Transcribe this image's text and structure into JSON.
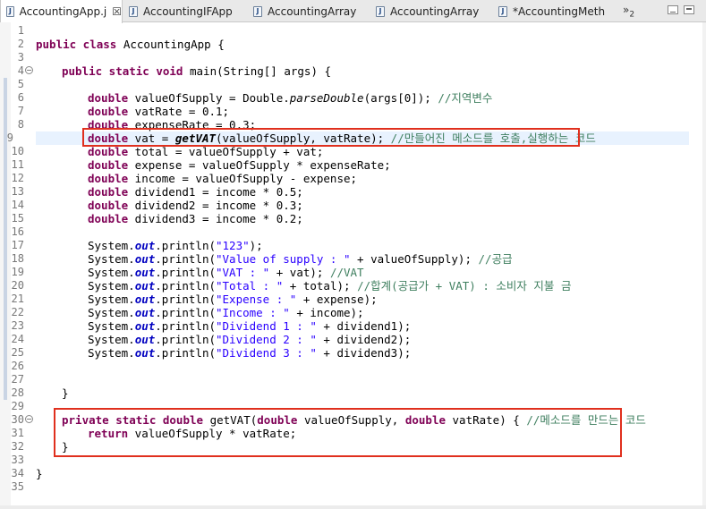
{
  "tabs": [
    {
      "label": "AccountingApp.j",
      "close": "☒",
      "active": true,
      "icon": "java-file-icon"
    },
    {
      "label": "AccountingIFApp",
      "active": false,
      "icon": "java-file-icon"
    },
    {
      "label": "AccountingArray",
      "active": false,
      "icon": "java-file-icon"
    },
    {
      "label": "AccountingArray",
      "active": false,
      "icon": "java-file-icon"
    },
    {
      "label": "*AccountingMeth",
      "active": false,
      "icon": "java-file-icon"
    }
  ],
  "overflow": {
    "symbol": "»",
    "count": "2"
  },
  "editor": {
    "current_line": 9,
    "line_numbers": [
      "1",
      "2",
      "3",
      "4",
      "5",
      "6",
      "7",
      "8",
      "9",
      "10",
      "11",
      "12",
      "13",
      "14",
      "15",
      "16",
      "17",
      "18",
      "19",
      "20",
      "21",
      "22",
      "23",
      "24",
      "25",
      "26",
      "27",
      "28",
      "29",
      "30",
      "31",
      "32",
      "33",
      "34",
      "35"
    ],
    "code": {
      "l2_kw": "public class",
      "l2_rest": " AccountingApp {",
      "l4_kw": "public static void",
      "l4_rest": " main(String[] args) {",
      "l6_kw": "double",
      "l6_a": " valueOfSupply = Double.",
      "l6_m": "parseDouble",
      "l6_b": "(args[0]); ",
      "l6_c": "//지역변수",
      "l7_kw": "double",
      "l7_rest": " vatRate = 0.1;",
      "l8_kw": "double",
      "l8_rest": " expenseRate = 0.3;",
      "l9_kw": "double",
      "l9_a": " vat = ",
      "l9_m": "getVAT",
      "l9_b": "(valueOfSupply, vatRate); ",
      "l9_c": "//만들어진 메소드를 호출,실행하는 코드",
      "l10_kw": "double",
      "l10_rest": " total = valueOfSupply + vat;",
      "l11_kw": "double",
      "l11_rest": " expense = valueOfSupply * expenseRate;",
      "l12_kw": "double",
      "l12_rest": " income = valueOfSupply - expense;",
      "l13_kw": "double",
      "l13_rest": " dividend1 = income * 0.5;",
      "l14_kw": "double",
      "l14_rest": " dividend2 = income * 0.3;",
      "l15_kw": "double",
      "l15_rest": " dividend3 = income * 0.2;",
      "sys": "System.",
      "out": "out",
      "println": ".println(",
      "l17_s": "\"123\"",
      "l17_e": ");",
      "l18_s": "\"Value of supply : \"",
      "l18_e": " + valueOfSupply); ",
      "l18_c": "//공급",
      "l19_s": "\"VAT : \"",
      "l19_e": " + vat); ",
      "l19_c": "//VAT",
      "l20_s": "\"Total : \"",
      "l20_e": " + total); ",
      "l20_c": "//합계(공급가 + VAT) : 소비자 지불 금",
      "l21_s": "\"Expense : \"",
      "l21_e": " + expense);",
      "l22_s": "\"Income : \"",
      "l22_e": " + income);",
      "l23_s": "\"Dividend 1 : \"",
      "l23_e": " + dividend1);",
      "l24_s": "\"Dividend 2 : \"",
      "l24_e": " + dividend2);",
      "l25_s": "\"Dividend 3 : \"",
      "l25_e": " + dividend3);",
      "close_brace": "}",
      "l30_kw": "private static double",
      "l30_a": " getVAT(",
      "l30_kw2": "double",
      "l30_b": " valueOfSupply, ",
      "l30_kw3": "double",
      "l30_c": " vatRate) { ",
      "l30_cmt": "//메소드를 만드는 코드",
      "l31_kw": "return",
      "l31_rest": " valueOfSupply * vatRate;"
    }
  },
  "colors": {
    "keyword": "#7f0055",
    "string": "#2a00ff",
    "comment": "#3f7f5f",
    "field": "#0000c0",
    "highlight_box": "#e0301e",
    "current_line": "#e8f2fe"
  }
}
